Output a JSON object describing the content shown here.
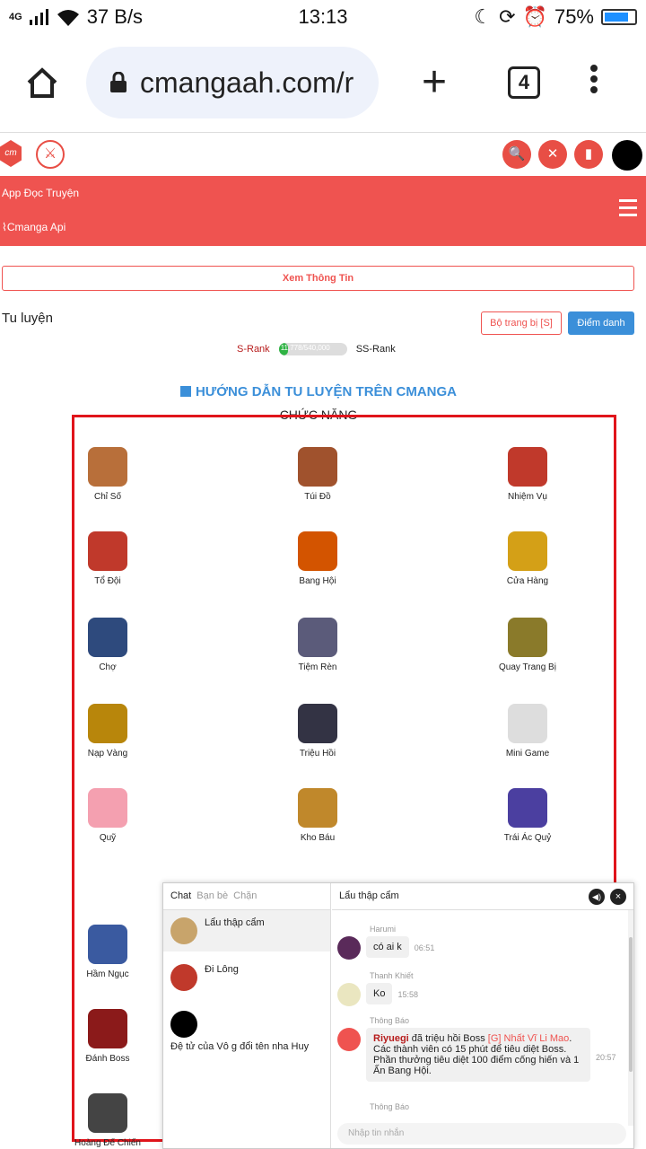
{
  "status_bar": {
    "network": "4G",
    "speed": "37 B/s",
    "time": "13:13",
    "battery": "75%",
    "battery_level": 0.75
  },
  "browser": {
    "url": "cmangaah.com/r",
    "tab_count": "4"
  },
  "site": {
    "logo_text": "cm",
    "nav_links": [
      "App Đọc Truyện",
      "Cmanga Api"
    ]
  },
  "cultivation": {
    "view_info_label": "Xem Thông Tin",
    "title": "Tu luyện",
    "equip_label": "Bộ trang bị [S]",
    "checkin_label": "Điểm danh",
    "rank_from": "S-Rank",
    "rank_to": "SS-Rank",
    "progress_text": "11,778/540,000",
    "progress_fraction": 0.0218,
    "guide_title": "HƯỚNG DẪN TU LUYỆN TRÊN CMANGA",
    "functions_title": "CHỨC NĂNG"
  },
  "features": [
    {
      "label": "Chỉ Số",
      "color": "#b86f3a"
    },
    {
      "label": "Túi Đồ",
      "color": "#a0522d"
    },
    {
      "label": "Nhiệm Vụ",
      "color": "#c0392b"
    },
    {
      "label": "Tổ Đội",
      "color": "#c0392b"
    },
    {
      "label": "Bang Hội",
      "color": "#d35400"
    },
    {
      "label": "Cửa Hàng",
      "color": "#d4a017"
    },
    {
      "label": "Chợ",
      "color": "#2e4a7d"
    },
    {
      "label": "Tiệm Rèn",
      "color": "#5b5b7a"
    },
    {
      "label": "Quay Trang Bị",
      "color": "#8a7a2a"
    },
    {
      "label": "Nạp Vàng",
      "color": "#b8860b"
    },
    {
      "label": "Triệu Hồi",
      "color": "#333344"
    },
    {
      "label": "Mini Game",
      "color": "#dddddd"
    },
    {
      "label": "Quỹ",
      "color": "#f4a0b0"
    },
    {
      "label": "Kho Báu",
      "color": "#c0882b"
    },
    {
      "label": "Trái Ác Quỷ",
      "color": "#4b3fa0"
    },
    {
      "label": "Hầm Ngục",
      "color": "#3a5aa0"
    },
    {
      "label": "Đánh Boss",
      "color": "#8b1a1a"
    },
    {
      "label": "Hoàng Đế Chiến",
      "color": "#444444"
    }
  ],
  "chat": {
    "tabs": [
      "Chat",
      "Bạn bè",
      "Chặn"
    ],
    "rooms": [
      {
        "name": "Lẩu thập cẩm"
      },
      {
        "name": "Đi Lông"
      },
      {
        "name": "Đệ tử của Vô g đổi tên nha Huy"
      }
    ],
    "current_room": "Lẩu thập cẩm",
    "messages": [
      {
        "name": "Harumi",
        "text": "có ai k",
        "time": "06:51"
      },
      {
        "name": "Thanh Khiết",
        "text": "Ko",
        "time": "15:58"
      },
      {
        "name": "Thông Báo",
        "highlight_user": "Riyuegi",
        "pre": "đã triệu hồi Boss",
        "highlight_boss": "[G] Nhất Vĩ Li Mao",
        "text": ". Các thành viên có 15 phút để tiêu diệt Boss. Phần thưởng tiêu diệt 100 điểm cống hiến và 1 Ấn Bang Hội.",
        "time": "20:57"
      },
      {
        "name": "Thông Báo"
      }
    ],
    "input_placeholder": "Nhập tin nhắn"
  }
}
